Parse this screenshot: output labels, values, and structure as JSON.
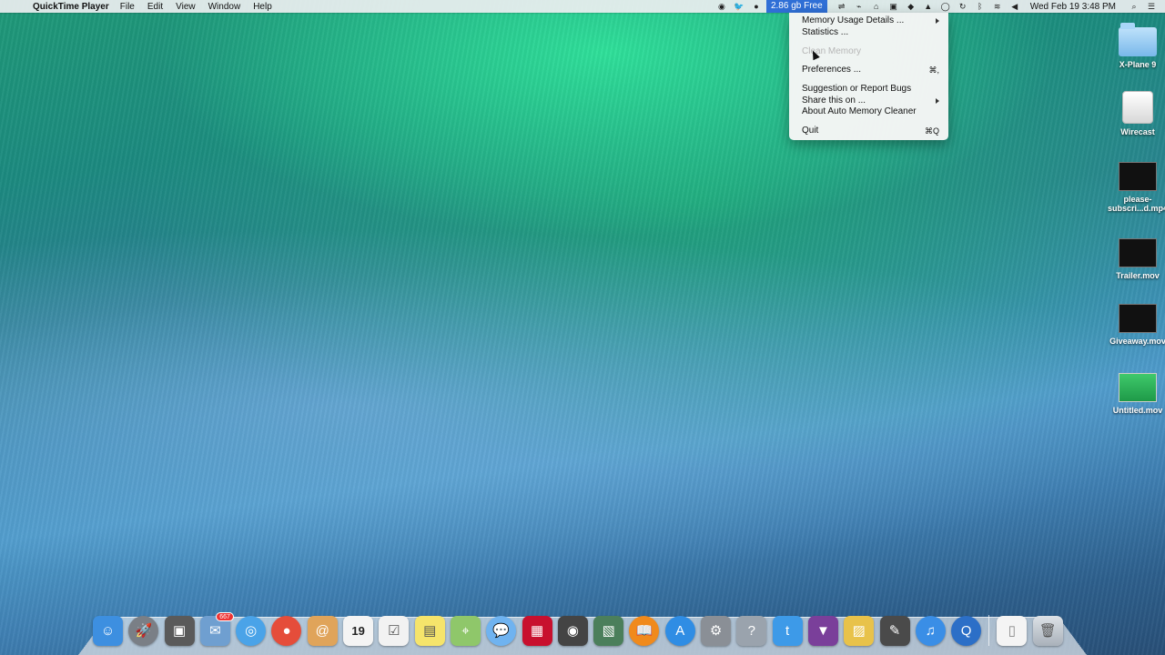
{
  "menubar": {
    "app_name": "QuickTime Player",
    "menus": [
      "File",
      "Edit",
      "View",
      "Window",
      "Help"
    ],
    "free_memory": "2.86 gb Free",
    "clock": "Wed Feb 19  3:48 PM"
  },
  "dropdown": {
    "items": [
      {
        "label": "Memory Usage Details ...",
        "shortcut": "",
        "submenu": true,
        "disabled": false
      },
      {
        "label": "Statistics ...",
        "shortcut": "",
        "submenu": false,
        "disabled": false
      },
      {
        "label": "Clean Memory",
        "shortcut": "",
        "submenu": false,
        "disabled": true
      },
      {
        "label": "Preferences ...",
        "shortcut": "⌘,",
        "submenu": false,
        "disabled": false
      },
      {
        "label": "Suggestion or Report Bugs",
        "shortcut": "",
        "submenu": false,
        "disabled": false
      },
      {
        "label": "Share this on ...",
        "shortcut": "",
        "submenu": true,
        "disabled": false
      },
      {
        "label": "About Auto Memory Cleaner",
        "shortcut": "",
        "submenu": false,
        "disabled": false
      },
      {
        "label": "Quit",
        "shortcut": "⌘Q",
        "submenu": false,
        "disabled": false
      }
    ]
  },
  "desktop_icons": [
    {
      "label": "X-Plane 9",
      "icon": "folder-icon"
    },
    {
      "label": "Wirecast",
      "icon": "drive-icon"
    },
    {
      "label": "please-subscri...d.mp4",
      "icon": "movie-file-icon"
    },
    {
      "label": "Trailer.mov",
      "icon": "movie-file-icon"
    },
    {
      "label": "Giveaway.mov",
      "icon": "movie-file-icon"
    },
    {
      "label": "Untitled.mov",
      "icon": "movie-file-icon"
    }
  ],
  "dock": {
    "mail_badge": "667",
    "calendar_day": "19",
    "items": [
      {
        "name": "finder-icon",
        "color": "#3d8fe0",
        "glyph": "☺"
      },
      {
        "name": "launchpad-icon",
        "color": "#7a7f86",
        "glyph": "🚀"
      },
      {
        "name": "image-capture-icon",
        "color": "#5a5a5a",
        "glyph": "▣"
      },
      {
        "name": "mail-icon",
        "color": "#6f9fd0",
        "glyph": "✉"
      },
      {
        "name": "safari-icon",
        "color": "#4aa3e8",
        "glyph": "◎"
      },
      {
        "name": "chrome-icon",
        "color": "#e54d3a",
        "glyph": "●"
      },
      {
        "name": "contacts-icon",
        "color": "#e0a45a",
        "glyph": "@"
      },
      {
        "name": "calendar-icon",
        "color": "#f4f4f4",
        "glyph": ""
      },
      {
        "name": "reminders-icon",
        "color": "#f2f2f2",
        "glyph": "☑"
      },
      {
        "name": "notes-icon",
        "color": "#f5e46b",
        "glyph": "▤"
      },
      {
        "name": "maps-icon",
        "color": "#8fc76a",
        "glyph": "⌖"
      },
      {
        "name": "messages-icon",
        "color": "#6fb3f0",
        "glyph": "💬"
      },
      {
        "name": "photo-booth-icon",
        "color": "#c8102e",
        "glyph": "▦"
      },
      {
        "name": "facetime-icon",
        "color": "#444",
        "glyph": "◉"
      },
      {
        "name": "iphoto-icon",
        "color": "#4b7f5b",
        "glyph": "▧"
      },
      {
        "name": "ibooks-icon",
        "color": "#f08a1c",
        "glyph": "📖"
      },
      {
        "name": "app-store-icon",
        "color": "#2f8de4",
        "glyph": "A"
      },
      {
        "name": "system-preferences-icon",
        "color": "#8a8f96",
        "glyph": "⚙"
      },
      {
        "name": "help-icon",
        "color": "#9aa3ad",
        "glyph": "?"
      },
      {
        "name": "twitter-icon",
        "color": "#3d9ae8",
        "glyph": "t"
      },
      {
        "name": "alfred-icon",
        "color": "#7a3f9a",
        "glyph": "▼"
      },
      {
        "name": "preview-icon",
        "color": "#e8c24a",
        "glyph": "▨"
      },
      {
        "name": "script-editor-icon",
        "color": "#4a4a4a",
        "glyph": "✎"
      },
      {
        "name": "itunes-icon",
        "color": "#3a8ee6",
        "glyph": "♫"
      },
      {
        "name": "quicktime-icon",
        "color": "#2c6fc7",
        "glyph": "Q"
      }
    ]
  }
}
